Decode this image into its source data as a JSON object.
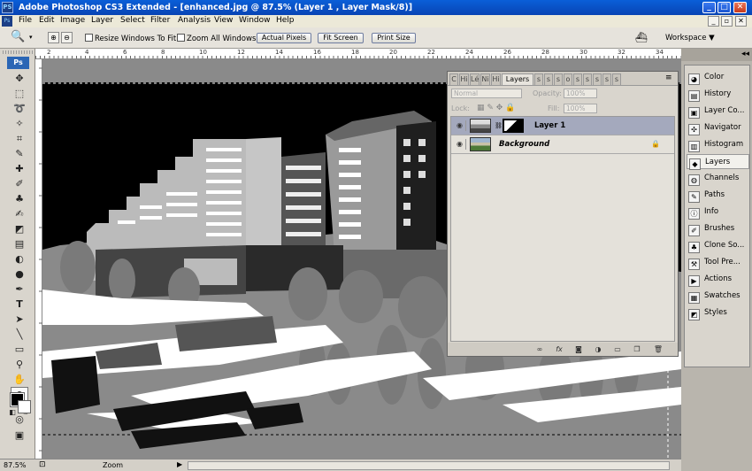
{
  "window": {
    "app_icon": "PS",
    "title": "Adobe Photoshop CS3 Extended - [enhanced.jpg @ 87.5% (Layer 1 , Layer Mask/8)]"
  },
  "menu": [
    "File",
    "Edit",
    "Image",
    "Layer",
    "Select",
    "Filter",
    "Analysis",
    "View",
    "Window",
    "Help"
  ],
  "options": {
    "resize_windows": "Resize Windows To Fit",
    "zoom_all": "Zoom All Windows",
    "actual_pixels": "Actual Pixels",
    "fit_screen": "Fit Screen",
    "print_size": "Print Size",
    "workspace": "Workspace ▼"
  },
  "toolbox": {
    "header": "Ps"
  },
  "ruler": {
    "ticks": [
      "2",
      "4",
      "6",
      "8",
      "10",
      "12",
      "14",
      "16",
      "18",
      "20",
      "22",
      "24",
      "26",
      "28",
      "30",
      "32",
      "34"
    ]
  },
  "layers_panel": {
    "tabs": [
      "C",
      "Hi",
      "Lé",
      "Ni",
      "Hi",
      "Layers",
      "s",
      "s",
      "s",
      "o",
      "s",
      "s",
      "s",
      "s",
      "s"
    ],
    "blend_mode": "Normal",
    "opacity_label": "Opacity:",
    "opacity_value": "100%",
    "lock_label": "Lock:",
    "fill_label": "Fill:",
    "fill_value": "100%",
    "layers": [
      {
        "name": "Layer 1",
        "selected": true
      },
      {
        "name": "Background",
        "selected": false
      }
    ]
  },
  "dock": {
    "items": [
      "Color",
      "History",
      "Layer Co...",
      "Navigator",
      "Histogram",
      "Layers",
      "Channels",
      "Paths",
      "Info",
      "Brushes",
      "Clone So...",
      "Tool Pre...",
      "Actions",
      "Swatches",
      "Styles"
    ],
    "selected": "Layers"
  },
  "status": {
    "zoom_value": "87.5%",
    "mode": "Zoom"
  }
}
